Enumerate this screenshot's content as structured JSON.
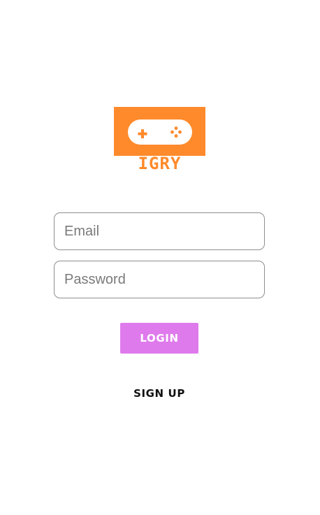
{
  "logo": {
    "text": "IGRY",
    "icon": "gamepad-icon",
    "color": "#ff8a2b"
  },
  "login_form": {
    "email_placeholder": "Email",
    "email_value": "",
    "password_placeholder": "Password",
    "password_value": "",
    "login_label": "LOGIN",
    "signup_label": "SIGN UP"
  },
  "colors": {
    "accent": "#df7aec",
    "brand": "#ff8a2b"
  }
}
